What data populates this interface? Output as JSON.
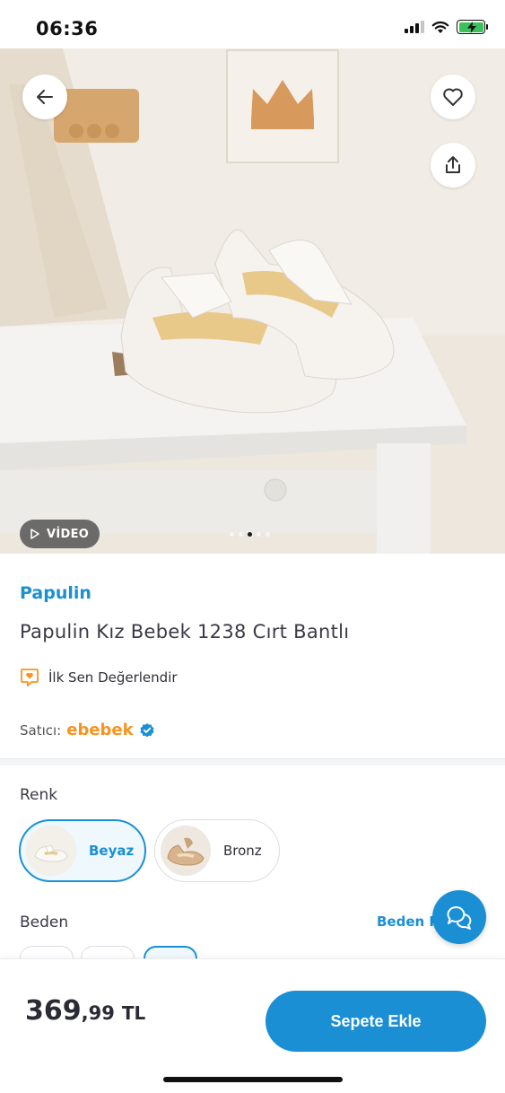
{
  "status_bar": {
    "time": "06:36"
  },
  "hero": {
    "video_label": "VİDEO",
    "dots_count": 5,
    "active_dot": 2
  },
  "product": {
    "brand": "Papulin",
    "title": "Papulin Kız Bebek 1238 Cırt Bantlı",
    "review_cta": "İlk Sen Değerlendir",
    "seller_label": "Satıcı:",
    "seller_name": "ebebek"
  },
  "options": {
    "color_label": "Renk",
    "colors": [
      {
        "label": "Beyaz",
        "selected": true
      },
      {
        "label": "Bronz",
        "selected": false
      }
    ],
    "size_label": "Beden",
    "size_guide": "Beden K"
  },
  "bottom": {
    "price_main": "369",
    "price_decimal": ",99",
    "currency": "TL",
    "add_to_cart": "Sepete Ekle"
  },
  "colors": {
    "accent": "#1a8fd4",
    "seller": "#f7931e"
  }
}
